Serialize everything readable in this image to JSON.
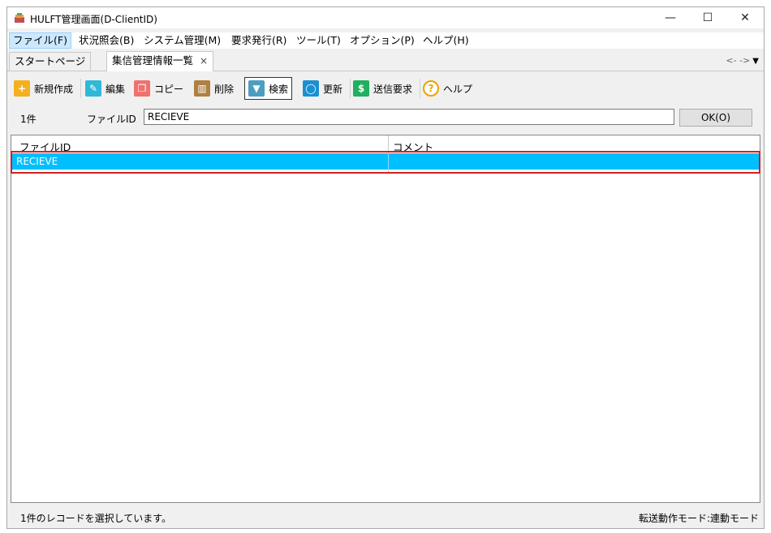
{
  "window": {
    "title": "HULFT管理画面(D-ClientID)",
    "min_glyph": "—",
    "max_glyph": "☐",
    "close_glyph": "✕"
  },
  "menu": [
    {
      "label": "ファイル(F)"
    },
    {
      "label": "状況照会(B)"
    },
    {
      "label": "システム管理(M)"
    },
    {
      "label": "要求発行(R)"
    },
    {
      "label": "ツール(T)"
    },
    {
      "label": "オプション(P)"
    },
    {
      "label": "ヘルプ(H)"
    }
  ],
  "tabs": {
    "start": "スタートページ",
    "active": "集信管理情報一覧",
    "close_glyph": "×",
    "nav": "<- ->",
    "dropdown_glyph": "▼"
  },
  "toolbar": {
    "new": "新規作成",
    "edit": "編集",
    "copy": "コピー",
    "delete": "削除",
    "search": "検索",
    "refresh": "更新",
    "send_request": "送信要求",
    "help": "ヘルプ"
  },
  "search": {
    "count": "1件",
    "field_label": "ファイルID",
    "field_value": "RECIEVE",
    "ok_label": "OK(O)"
  },
  "grid": {
    "columns": [
      "ファイルID",
      "コメント"
    ],
    "rows": [
      {
        "file_id": "RECIEVE",
        "comment": ""
      }
    ]
  },
  "status": {
    "left": "1件のレコードを選択しています。",
    "right": "転送動作モード:連動モード"
  },
  "colors": {
    "selected_row": "#00bfff",
    "highlight_border": "#d42020",
    "menu_active": "#cce8ff"
  }
}
